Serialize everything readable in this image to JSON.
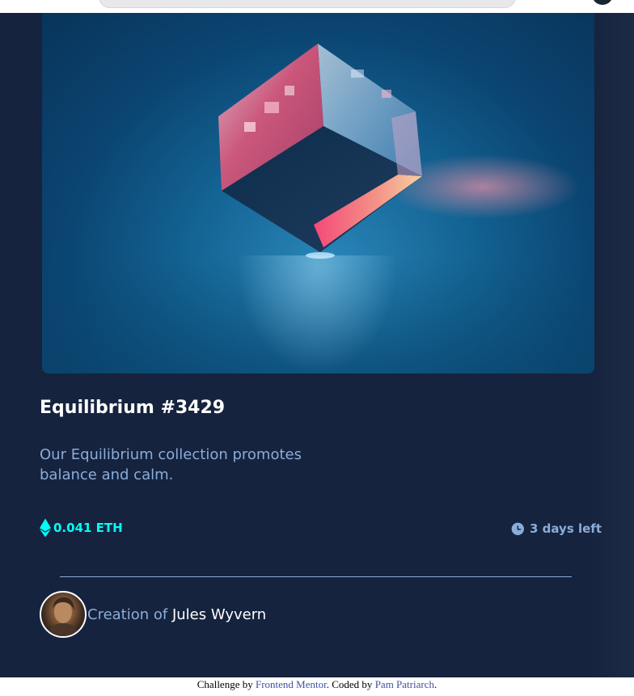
{
  "nft": {
    "title": "Equilibrium #3429",
    "description": "Our Equilibrium collection promotes balance and calm.",
    "price": "0.041 ETH",
    "time_left": "3 days left",
    "creator_prefix": "Creation of",
    "creator_name": "Jules Wyvern",
    "icons": {
      "price": "ethereum-icon",
      "time": "clock-icon"
    }
  },
  "footer": {
    "prefix": "Challenge by",
    "mentor_link": "Frontend Mentor",
    "middle": ". Coded by",
    "author_link": "Pam Patriarch",
    "suffix": "."
  },
  "colors": {
    "background": "#15233e",
    "price_cyan": "#00fff8",
    "soft_blue": "#8bacd9",
    "white": "#ffffff",
    "link": "#3e52a3"
  }
}
